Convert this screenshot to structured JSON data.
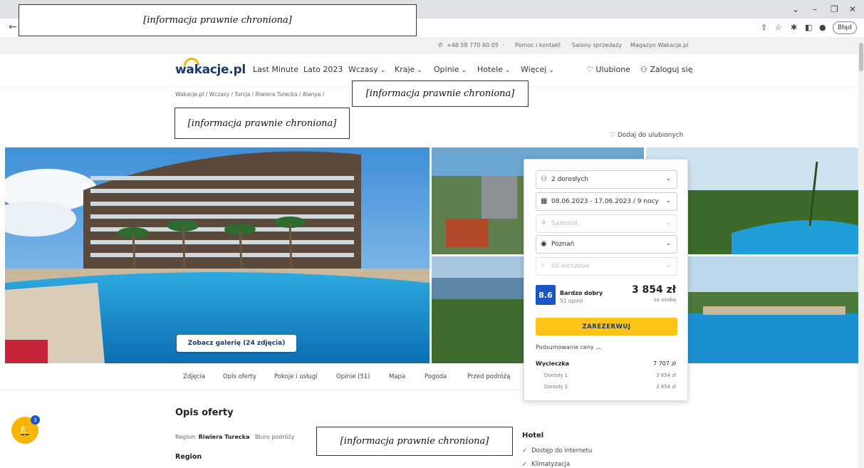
{
  "browser": {
    "redacted": "[informacja prawnie chroniona]",
    "error_pill": "Błąd",
    "win_min": "–",
    "win_max": "❐",
    "win_close": "✕",
    "tab_chevron": "⌄"
  },
  "utilbar": {
    "phone": "+48 58 770 60 05",
    "help": "Pomoc i kontakt",
    "stores": "Salony sprzedaży",
    "magazine": "Magazyn Wakacje.pl"
  },
  "nav": {
    "logo": "wakacje.pl",
    "items": [
      "Last Minute",
      "Lato 2023",
      "Wczasy",
      "Kraje",
      "Opinie",
      "Hotele",
      "Więcej"
    ],
    "favorites": "Ulubione",
    "login": "Zaloguj się"
  },
  "breadcrumb": "Wakacje.pl  /  Wczasy  /  Turcja  /  Riwiera Turecka  /  Alanya  /",
  "redacted": {
    "top_bar": "[informacja prawnie chroniona]",
    "breadcrumb": "[informacja prawnie chroniona]",
    "title": "[informacja prawnie chroniona]",
    "body": "[informacja prawnie chroniona]"
  },
  "favorite_link": "Dodaj do ulubionych",
  "gallery_button": "Zobacz galerię (24 zdjęcia)",
  "booking": {
    "persons": "2 dorosłych",
    "dates": "08.06.2023 - 17.06.2023 / 9 nocy",
    "transport": "Samolot",
    "departure": "Poznań",
    "board": "All Inclusive",
    "score": "8.6",
    "rating_label": "Bardzo dobry",
    "rating_count": "51 opinii",
    "price": "3 854 zł",
    "per_person": "za osobę",
    "book_button": "ZAREZERWUJ",
    "summary_label": "Podsumowanie ceny",
    "trip_label": "Wycieczka",
    "trip_total": "7 707 zł",
    "adult1_label": "Dorosły 1",
    "adult1_price": "3 854 zł",
    "adult2_label": "Dorosły 2",
    "adult2_price": "3 854 zł"
  },
  "tabs": [
    "Zdjęcia",
    "Opis oferty",
    "Pokoje i usługi",
    "Opinie (51)",
    "Mapa",
    "Pogoda",
    "Przed podróżą"
  ],
  "notification_count": "3",
  "offer": {
    "heading": "Opis oferty",
    "region_label": "Region:",
    "region_value": "Riwiera Turecka",
    "agency_label": "Biuro podróży",
    "region_heading": "Region",
    "hotel_heading": "Hotel",
    "amenities": [
      "Dostęp do internetu",
      "Klimatyzacja"
    ]
  },
  "colors": {
    "brand": "#1a3a6b",
    "accent": "#fcc419",
    "score": "#1a56c4"
  }
}
